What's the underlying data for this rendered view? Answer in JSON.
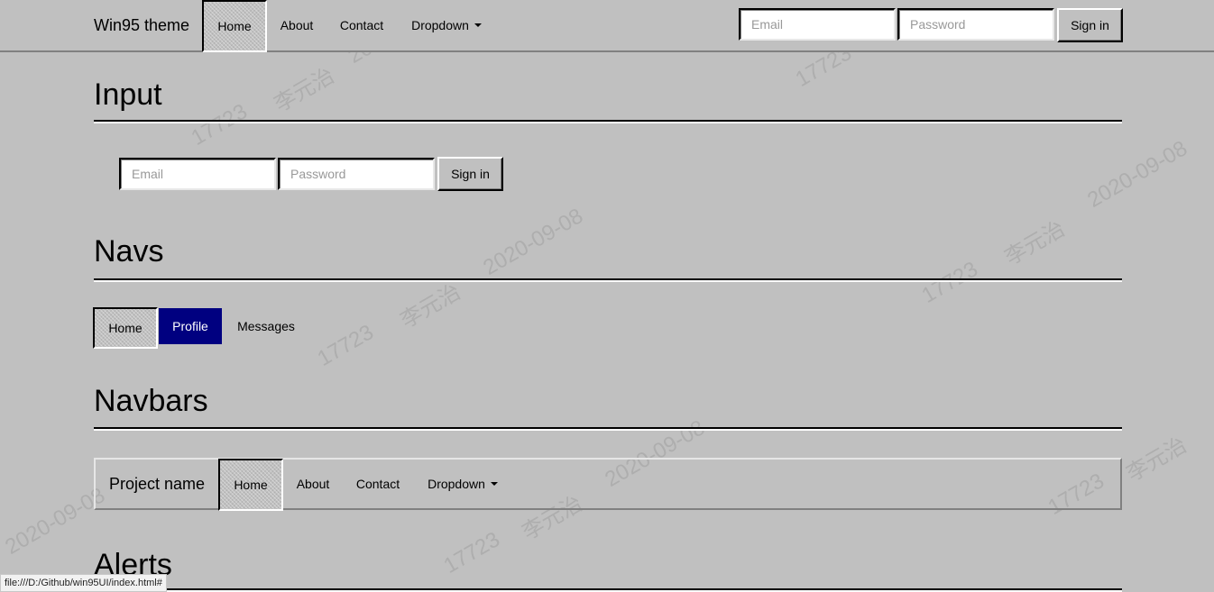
{
  "topbar": {
    "brand": "Win95 theme",
    "nav": [
      "Home",
      "About",
      "Contact",
      "Dropdown"
    ],
    "email_placeholder": "Email",
    "password_placeholder": "Password",
    "signin_label": "Sign in"
  },
  "sections": {
    "input": {
      "title": "Input",
      "email_placeholder": "Email",
      "password_placeholder": "Password",
      "signin_label": "Sign in"
    },
    "navs": {
      "title": "Navs",
      "pills": [
        "Home",
        "Profile",
        "Messages"
      ]
    },
    "navbars": {
      "title": "Navbars",
      "brand": "Project name",
      "nav": [
        "Home",
        "About",
        "Contact",
        "Dropdown"
      ]
    },
    "alerts": {
      "title": "Alerts"
    }
  },
  "watermark": {
    "texts": [
      "2020-09-08",
      "李元治",
      "17723"
    ]
  },
  "statusbar": {
    "url": "file:///D:/Github/win95UI/index.html#"
  },
  "colors": {
    "background": "#c0c0c0",
    "primary": "#000080"
  }
}
